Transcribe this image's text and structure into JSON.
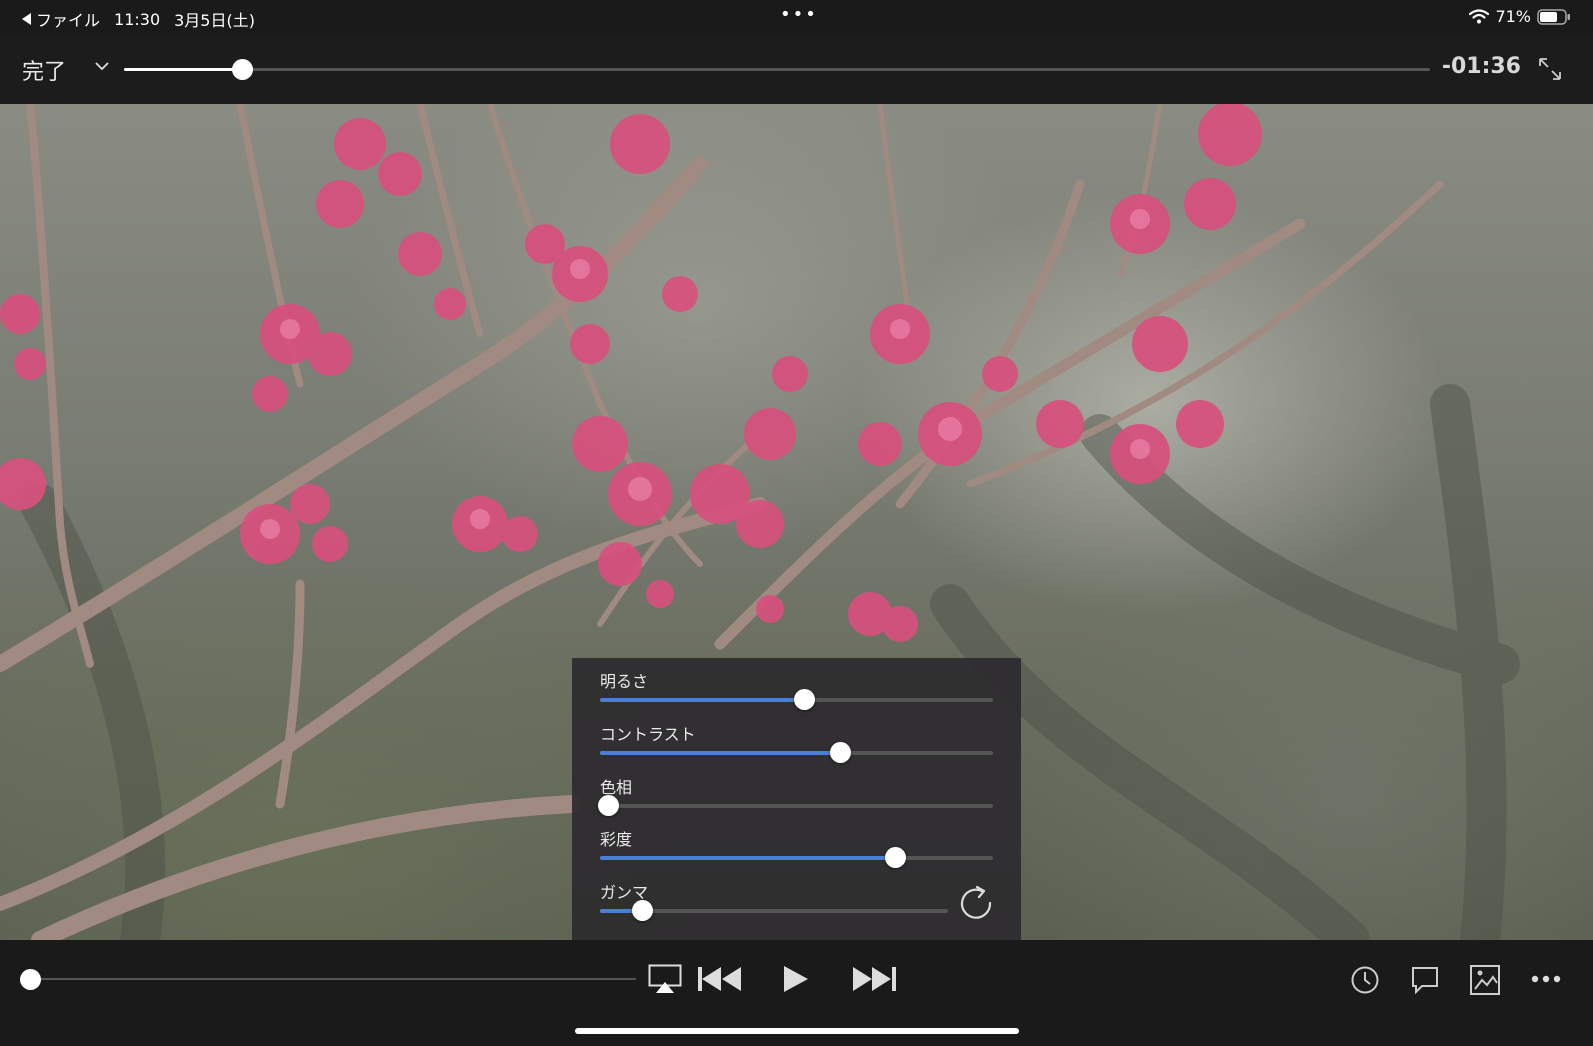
{
  "status_bar": {
    "back_label": "ファイル",
    "time": "11:30",
    "date": "3月5日(土)",
    "dots": "•••",
    "battery_percent": "71%",
    "battery_level": 0.71
  },
  "top_bar": {
    "done_label": "完了",
    "remaining_time": "-01:36",
    "progress": 0.09
  },
  "adjustments": {
    "items": [
      {
        "label": "明るさ",
        "value": 0.52
      },
      {
        "label": "コントラスト",
        "value": 0.61
      },
      {
        "label": "色相",
        "value": 0.02
      },
      {
        "label": "彩度",
        "value": 0.75
      },
      {
        "label": "ガンマ",
        "value": 0.12
      }
    ],
    "accent_color": "#4a7fd8",
    "reset_icon": "reset-icon"
  },
  "bottom_bar": {
    "position": 0.0,
    "icons": [
      "airplay-icon",
      "skip-back-icon",
      "play-icon",
      "skip-forward-icon",
      "timer-icon",
      "subtitles-icon",
      "picture-icon",
      "more-icon"
    ]
  }
}
